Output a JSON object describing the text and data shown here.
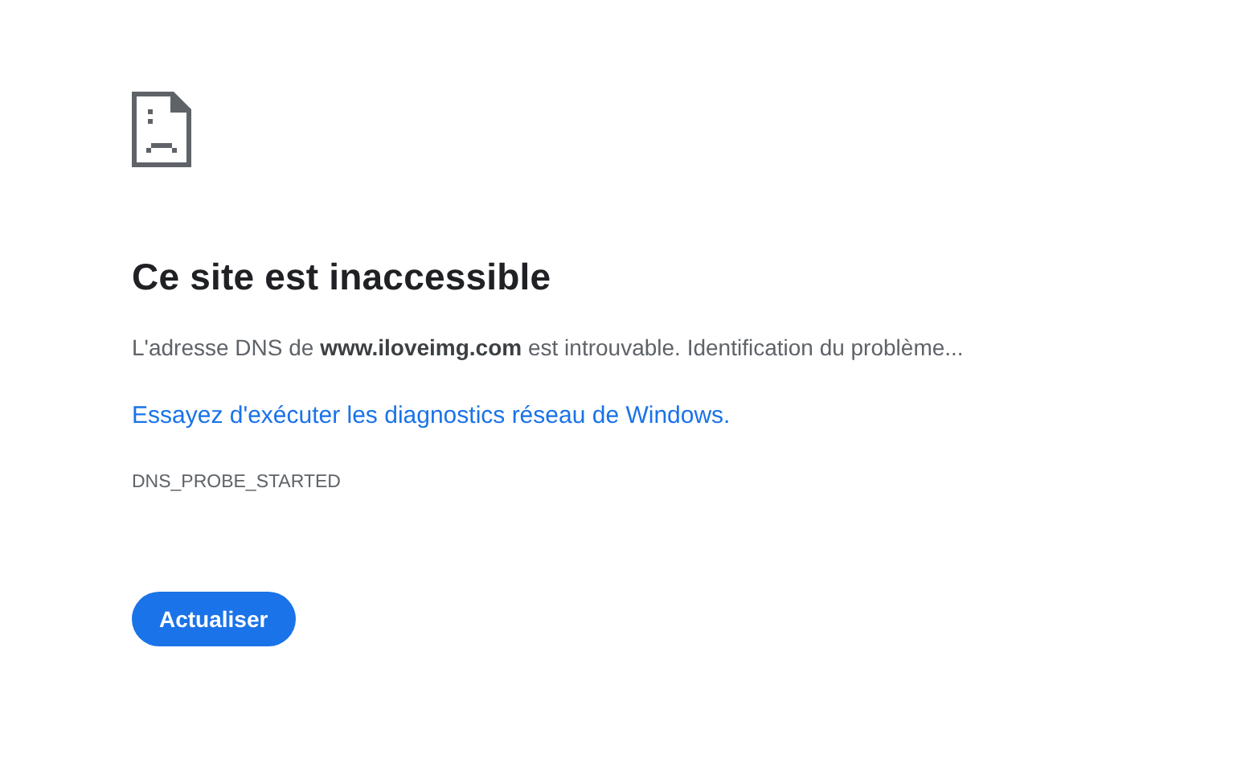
{
  "heading": "Ce site est inaccessible",
  "summary": "L'adresse DNS de **www.iloveimg.com** est introuvable. Identification du problème...",
  "suggestion_link": "Essayez d'exécuter les diagnostics réseau de Windows.",
  "error_code": "DNS_PROBE_STARTED",
  "buttons": [
    "Actualiser"
  ]
}
